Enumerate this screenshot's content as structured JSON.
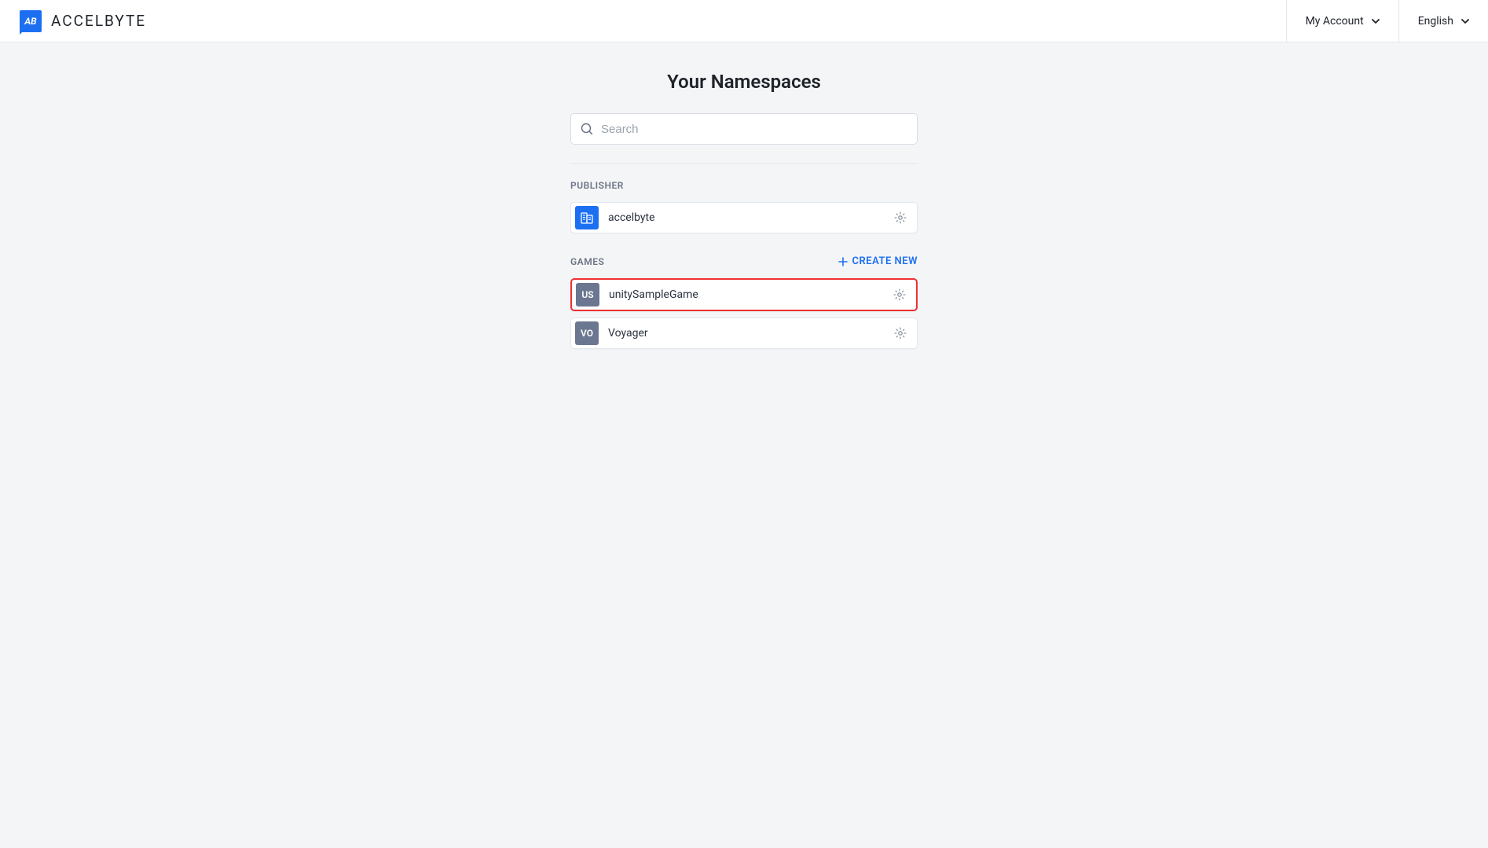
{
  "header": {
    "brand": "ACCELBYTE",
    "my_account_label": "My Account",
    "language_label": "English"
  },
  "page": {
    "title": "Your Namespaces"
  },
  "search": {
    "placeholder": "Search"
  },
  "sections": {
    "publisher": {
      "label": "PUBLISHER",
      "items": [
        {
          "name": "accelbyte",
          "icon_type": "building"
        }
      ]
    },
    "games": {
      "label": "GAMES",
      "create_label": "CREATE NEW",
      "items": [
        {
          "abbr": "US",
          "name": "unitySampleGame",
          "highlighted": true
        },
        {
          "abbr": "VO",
          "name": "Voyager",
          "highlighted": false
        }
      ]
    }
  }
}
